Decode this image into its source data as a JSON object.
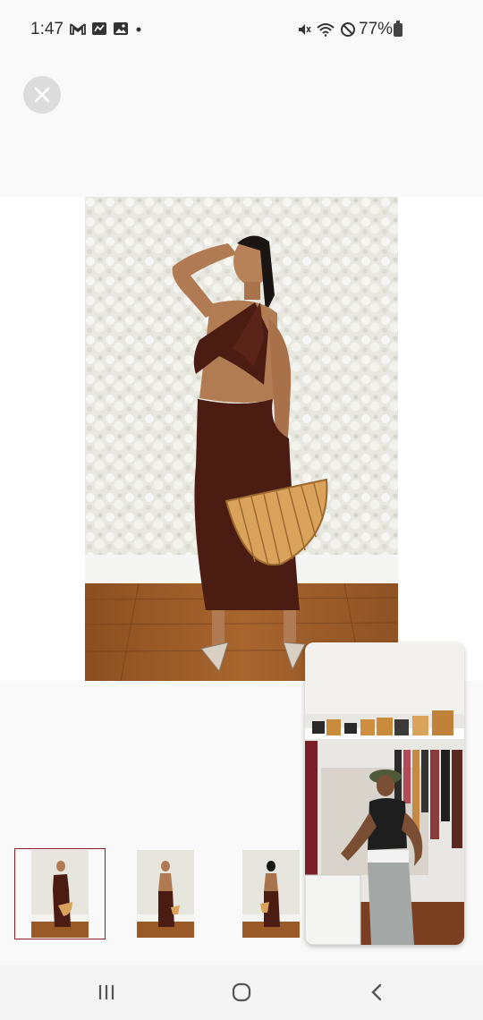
{
  "status_bar": {
    "time": "1:47",
    "battery": "77%",
    "left_icons": [
      "gmail-icon",
      "analytics-icon",
      "gallery-icon",
      "dot-icon"
    ],
    "right_icons": [
      "mute-icon",
      "wifi-icon",
      "dnd-icon",
      "battery-icon"
    ]
  },
  "viewer": {
    "close_label": "Close",
    "thumbnail_count": 3,
    "selected_thumbnail": 0
  },
  "colors": {
    "dress": "#4a1c12",
    "selected_border": "#8a1f2b",
    "floor": "#9a5a28",
    "wall": "#eceae3"
  },
  "nav": {
    "buttons": [
      "recents-icon",
      "home-icon",
      "back-icon"
    ]
  }
}
